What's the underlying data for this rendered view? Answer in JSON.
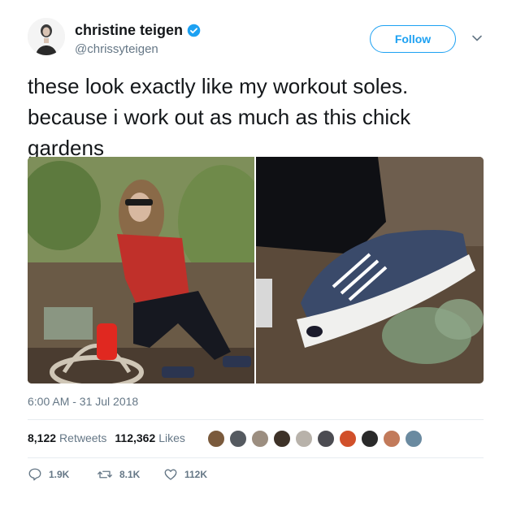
{
  "user": {
    "display_name": "christine teigen",
    "handle": "@chrissyteigen",
    "verified": true
  },
  "follow_button": {
    "label": "Follow"
  },
  "tweet": {
    "lines": [
      "these look exactly like my workout soles.",
      "because i work out as much as this chick",
      "gardens"
    ],
    "timestamp": "6:00 AM - 31 Jul 2018"
  },
  "media": {
    "photos": [
      {
        "description": "woman in red plaid shirt and sunglasses gardening"
      },
      {
        "description": "close-up of navy canvas sneaker"
      }
    ]
  },
  "stats": {
    "retweets_count": "8,122",
    "retweets_label": "Retweets",
    "likes_count": "112,362",
    "likes_label": "Likes"
  },
  "actions": {
    "reply_count": "1.9K",
    "retweet_count": "8.1K",
    "like_count": "112K"
  },
  "colors": {
    "accent": "#1da1f2",
    "secondary_text": "#657786"
  },
  "icons": [
    "verified-icon",
    "caret-down-icon",
    "reply-icon",
    "retweet-icon",
    "like-icon"
  ]
}
